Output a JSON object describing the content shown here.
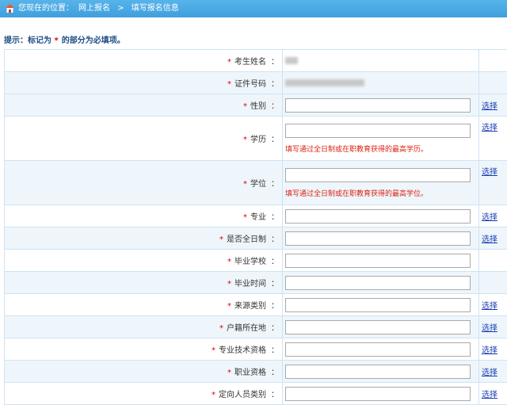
{
  "breadcrumb": {
    "prefix": "您现在的位置：",
    "level1": "网上报名",
    "separator": ">",
    "level2": "填写报名信息"
  },
  "hint": {
    "text_before": "提示：标记为",
    "star": "*",
    "text_after": "的部分为必填项。"
  },
  "colon": "：",
  "required_mark": "*",
  "choose_label": "选择",
  "fields": {
    "name": {
      "label": "考生姓名"
    },
    "id_number": {
      "label": "证件号码"
    },
    "gender": {
      "label": "性别",
      "value": ""
    },
    "education": {
      "label": "学历",
      "value": "",
      "note": "填写通过全日制或在职教育获得的最高学历。"
    },
    "degree": {
      "label": "学位",
      "value": "",
      "note": "填写通过全日制或在职教育获得的最高学位。"
    },
    "major": {
      "label": "专业",
      "value": ""
    },
    "full_time": {
      "label": "是否全日制",
      "value": ""
    },
    "school": {
      "label": "毕业学校",
      "value": ""
    },
    "grad_time": {
      "label": "毕业时间",
      "value": ""
    },
    "source": {
      "label": "来源类别",
      "value": ""
    },
    "household": {
      "label": "户籍所在地",
      "value": ""
    },
    "tech_title": {
      "label": "专业技术资格",
      "value": ""
    },
    "vocational": {
      "label": "职业资格",
      "value": ""
    },
    "targeted": {
      "label": "定向人员类别",
      "value": ""
    }
  },
  "colors": {
    "header_bar": "#4aa8e4",
    "row_alt": "#eef6fc",
    "required": "#dd0000",
    "link": "#1a3fb0"
  }
}
